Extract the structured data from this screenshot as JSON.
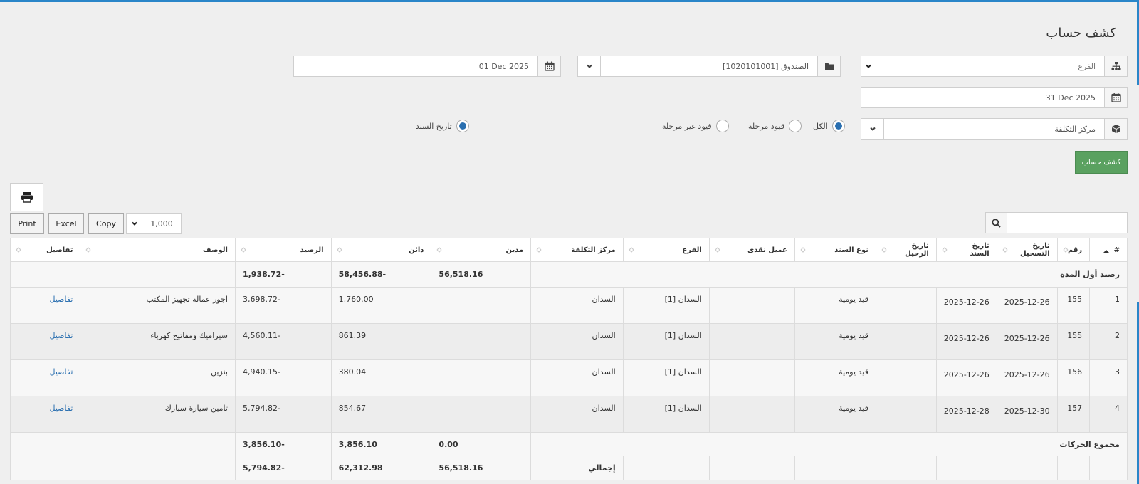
{
  "page": {
    "title": "كشف حساب"
  },
  "filters": {
    "date_from": "01 Dec 2025",
    "account": "[1020101001] الصندوق",
    "branch_placeholder": "الفرع",
    "date_to": "31 Dec 2025",
    "cost_center_placeholder": "مركز التكلفة",
    "radios": [
      {
        "label": "الكل",
        "checked": true
      },
      {
        "label": "قيود مرحلة",
        "checked": false
      },
      {
        "label": "قيود غير مرحلة",
        "checked": false
      },
      {
        "label": "تاريخ السند",
        "checked": true
      }
    ],
    "submit_label": "كشف حساب"
  },
  "toolbar": {
    "print": "Print",
    "excel": "Excel",
    "copy": "Copy",
    "page_size": "1,000"
  },
  "table": {
    "headers": [
      "#",
      "رقم",
      "تاريخ التسجيل",
      "تاريخ السند",
      "تاريخ الرحيل",
      "نوع السند",
      "عميل نقدى",
      "الفرع",
      "مركز التكلفة",
      "مدين",
      "دائن",
      "الرصيد",
      "الوصف",
      "تفاصيل"
    ],
    "opening": {
      "label": "رصيد أول المدة",
      "debit": "56,518.16",
      "credit": "58,456.88-",
      "balance": "1,938.72-"
    },
    "rows": [
      {
        "idx": "1",
        "num": "155",
        "reg": "2025-12-26",
        "doc": "2025-12-26",
        "type": "قيد يومية",
        "branch": "السدان [1]",
        "cost": "السدان",
        "credit": "1,760.00",
        "balance": "3,698.72-",
        "desc": "اجور عمالة تجهيز المكتب",
        "details": "تفاصيل"
      },
      {
        "idx": "2",
        "num": "155",
        "reg": "2025-12-26",
        "doc": "2025-12-26",
        "type": "قيد يومية",
        "branch": "السدان [1]",
        "cost": "السدان",
        "credit": "861.39",
        "balance": "4,560.11-",
        "desc": "سيراميك ومفاتيح كهرباء",
        "details": "تفاصيل"
      },
      {
        "idx": "3",
        "num": "156",
        "reg": "2025-12-26",
        "doc": "2025-12-26",
        "type": "قيد يومية",
        "branch": "السدان [1]",
        "cost": "السدان",
        "credit": "380.04",
        "balance": "4,940.15-",
        "desc": "بنزين",
        "details": "تفاصيل"
      },
      {
        "idx": "4",
        "num": "157",
        "reg": "2025-12-30",
        "doc": "2025-12-28",
        "type": "قيد يومية",
        "branch": "السدان [1]",
        "cost": "السدان",
        "credit": "854.67",
        "balance": "5,794.82-",
        "desc": "تامين سيارة سبارك",
        "details": "تفاصيل"
      }
    ],
    "movements": {
      "label": "مجموع الحركات",
      "debit": "0.00",
      "credit": "3,856.10",
      "balance": "3,856.10-"
    },
    "grand": {
      "label": "إجمالي",
      "debit": "56,518.16",
      "credit": "62,312.98",
      "balance": "5,794.82-"
    }
  },
  "icons": [
    "calendar-icon",
    "folder-icon",
    "sitemap-icon",
    "cube-icon",
    "chevron-down-icon",
    "print-icon",
    "search-icon",
    "sort-icon"
  ],
  "colors": {
    "accent": "#2a86c9",
    "submit": "#5aa160",
    "link": "#2a6fb0"
  }
}
